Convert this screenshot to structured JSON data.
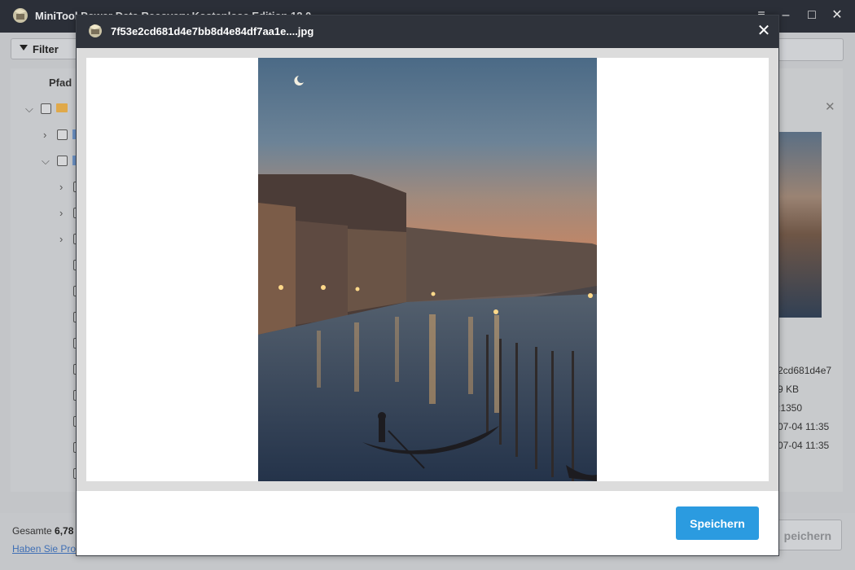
{
  "app": {
    "title": "MiniTool Power Data Recovery Kostenlose Edition 12.0",
    "filter_label": "Filter",
    "tree": {
      "path_header": "Pfad"
    },
    "details": {
      "filename_fragment": "2cd681d4e7",
      "size_fragment": "9 KB",
      "dimension_fragment": ":1350",
      "created_fragment": "07-04 11:35",
      "modified_fragment": "07-04 11:35"
    },
    "status": {
      "total_label": "Gesamte",
      "total_value": "6,78",
      "help_link": "Haben Sie Pro"
    },
    "save_label_bg": "peichern"
  },
  "modal": {
    "title": "7f53e2cd681d4e7bb8d4e84df7aa1e....jpg",
    "close_glyph": "✕",
    "save_label": "Speichern"
  },
  "colors": {
    "accent": "#2b9be0",
    "header_dark": "#2f333b",
    "folder": "#e0a94a"
  }
}
